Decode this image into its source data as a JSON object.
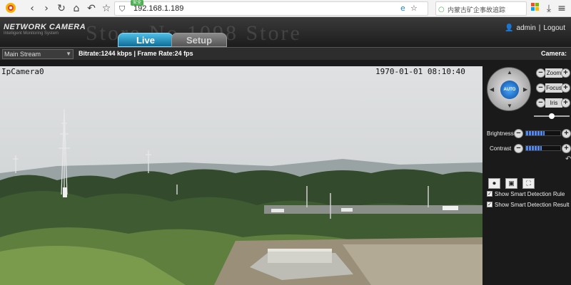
{
  "browser": {
    "url": "192.168.1.189",
    "security_badge": "安全",
    "search_text": "内蒙古矿企事故追踪",
    "icons": [
      "back-icon",
      "forward-icon",
      "reload-icon",
      "home-icon",
      "undo-icon",
      "star-icon",
      "shield-icon",
      "ie-icon",
      "star-icon",
      "windows-icon",
      "download-icon",
      "menu-icon"
    ]
  },
  "header": {
    "brand": "NETWORK CAMERA",
    "brand_sub": "Intelligent Monitoring System",
    "watermark": "Store No.1098 Store",
    "tabs": [
      {
        "label": "Live",
        "active": true
      },
      {
        "label": "Setup",
        "active": false
      }
    ],
    "user": "admin",
    "separator": "|",
    "logout": "Logout"
  },
  "toolbar": {
    "stream": "Main Stream",
    "stats": "Bitrate:1244 kbps | Frame Rate:24 fps",
    "camera_label": "Camera:"
  },
  "video": {
    "name": "IpCamera0",
    "timestamp": "1970-01-01  08:10:40"
  },
  "panel": {
    "ptz_center": "AUTO",
    "zoom": "Zoom",
    "focus": "Focus",
    "iris": "Iris",
    "brightness": "Brightness",
    "contrast": "Contrast",
    "brightness_level": 0.55,
    "contrast_level": 0.45,
    "slider_level": 0.5,
    "options": [
      {
        "label": "Show Smart Detection Rule",
        "checked": true
      },
      {
        "label": "Show Smart Detection Result",
        "checked": true
      }
    ]
  },
  "colors": {
    "accent": "#1e88c8",
    "panel": "#1a1a1a",
    "bar": "#4a8bf5"
  }
}
